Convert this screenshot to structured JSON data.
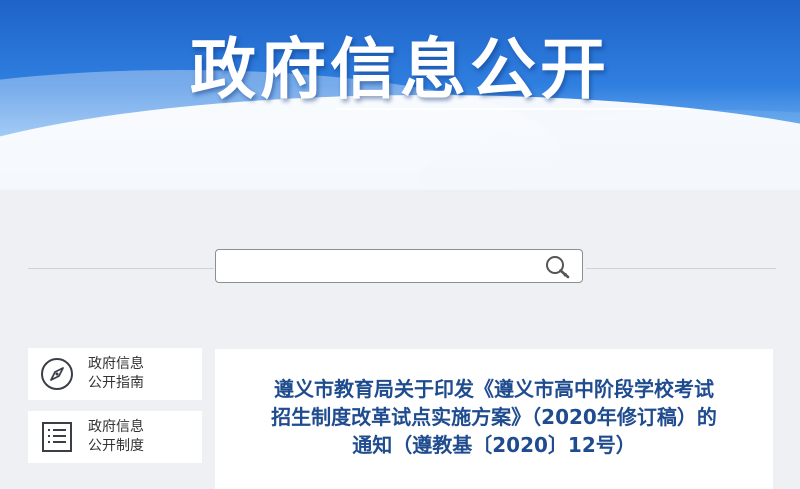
{
  "banner": {
    "title": "政府信息公开"
  },
  "search": {
    "value": "",
    "placeholder": ""
  },
  "sidebar": {
    "items": [
      {
        "line1": "政府信息",
        "line2": "公开指南",
        "icon": "compass-icon"
      },
      {
        "line1": "政府信息",
        "line2": "公开制度",
        "icon": "list-document-icon"
      }
    ]
  },
  "notice": {
    "line1": "遵义市教育局关于印发《遵义市高中阶段学校考试",
    "line2": "招生制度改革试点实施方案》（2020年修订稿）的",
    "line3": "通知（遵教基〔2020〕12号）"
  },
  "colors": {
    "banner_blue": "#2f7fe0",
    "title_blue": "#1f4c8f",
    "page_bg": "#eef0f3"
  }
}
